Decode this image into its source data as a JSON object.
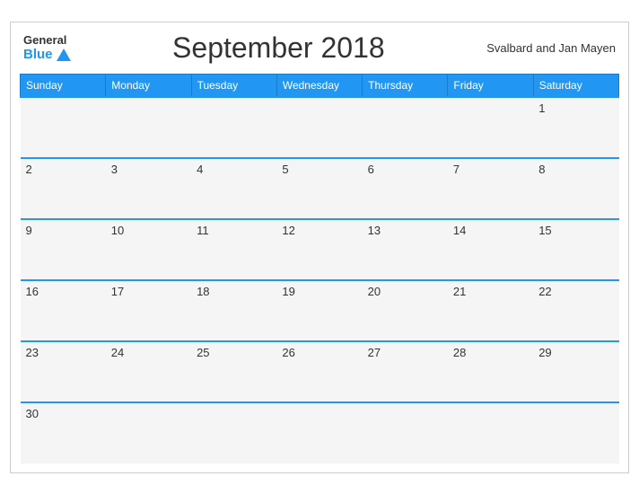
{
  "header": {
    "logo_general": "General",
    "logo_blue": "Blue",
    "title": "September 2018",
    "region": "Svalbard and Jan Mayen"
  },
  "weekdays": [
    "Sunday",
    "Monday",
    "Tuesday",
    "Wednesday",
    "Thursday",
    "Friday",
    "Saturday"
  ],
  "weeks": [
    [
      {
        "day": "",
        "empty": true
      },
      {
        "day": "",
        "empty": true
      },
      {
        "day": "",
        "empty": true
      },
      {
        "day": "",
        "empty": true
      },
      {
        "day": "",
        "empty": true
      },
      {
        "day": "",
        "empty": true
      },
      {
        "day": "1",
        "empty": false
      }
    ],
    [
      {
        "day": "2",
        "empty": false
      },
      {
        "day": "3",
        "empty": false
      },
      {
        "day": "4",
        "empty": false
      },
      {
        "day": "5",
        "empty": false
      },
      {
        "day": "6",
        "empty": false
      },
      {
        "day": "7",
        "empty": false
      },
      {
        "day": "8",
        "empty": false
      }
    ],
    [
      {
        "day": "9",
        "empty": false
      },
      {
        "day": "10",
        "empty": false
      },
      {
        "day": "11",
        "empty": false
      },
      {
        "day": "12",
        "empty": false
      },
      {
        "day": "13",
        "empty": false
      },
      {
        "day": "14",
        "empty": false
      },
      {
        "day": "15",
        "empty": false
      }
    ],
    [
      {
        "day": "16",
        "empty": false
      },
      {
        "day": "17",
        "empty": false
      },
      {
        "day": "18",
        "empty": false
      },
      {
        "day": "19",
        "empty": false
      },
      {
        "day": "20",
        "empty": false
      },
      {
        "day": "21",
        "empty": false
      },
      {
        "day": "22",
        "empty": false
      }
    ],
    [
      {
        "day": "23",
        "empty": false
      },
      {
        "day": "24",
        "empty": false
      },
      {
        "day": "25",
        "empty": false
      },
      {
        "day": "26",
        "empty": false
      },
      {
        "day": "27",
        "empty": false
      },
      {
        "day": "28",
        "empty": false
      },
      {
        "day": "29",
        "empty": false
      }
    ],
    [
      {
        "day": "30",
        "empty": false
      },
      {
        "day": "",
        "empty": true
      },
      {
        "day": "",
        "empty": true
      },
      {
        "day": "",
        "empty": true
      },
      {
        "day": "",
        "empty": true
      },
      {
        "day": "",
        "empty": true
      },
      {
        "day": "",
        "empty": true
      }
    ]
  ]
}
